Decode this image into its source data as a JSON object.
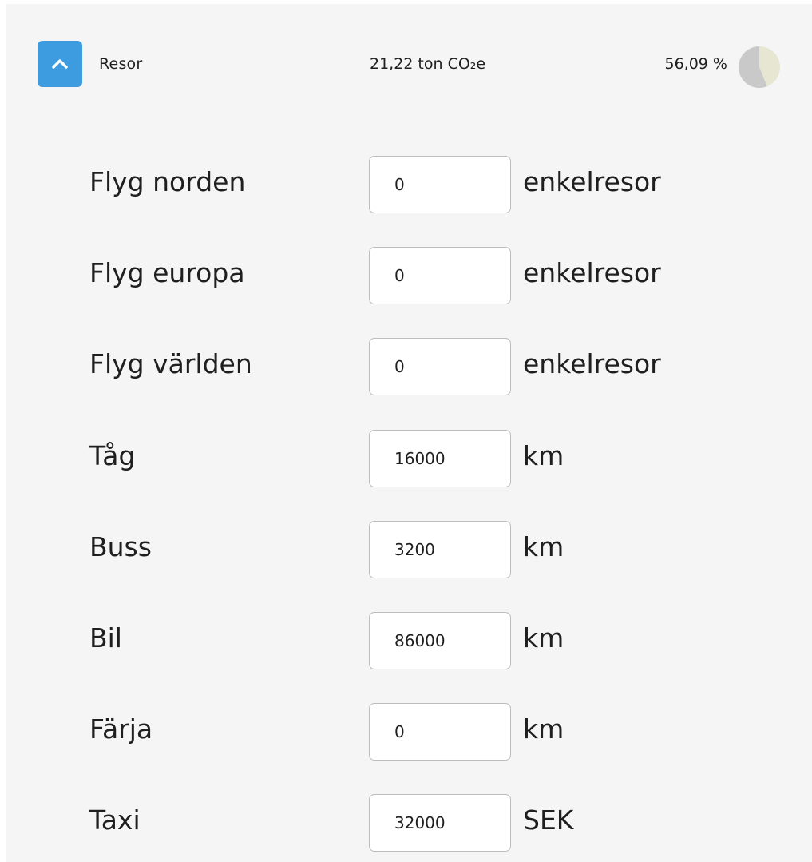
{
  "section": {
    "title": "Resor",
    "total": "21,22 ton CO₂e",
    "percent_label": "56,09 %",
    "percent_value": 56.09,
    "pie_colors": {
      "fill": "#c9c9c9",
      "background": "#e6e6d2"
    }
  },
  "toggle": {
    "icon": "chevron-up-icon",
    "color": "#3d9be0"
  },
  "rows": [
    {
      "label": "Flyg norden",
      "value": "0",
      "unit": "enkelresor"
    },
    {
      "label": "Flyg europa",
      "value": "0",
      "unit": "enkelresor"
    },
    {
      "label": "Flyg världen",
      "value": "0",
      "unit": "enkelresor"
    },
    {
      "label": "Tåg",
      "value": "16000",
      "unit": "km"
    },
    {
      "label": "Buss",
      "value": "3200",
      "unit": "km"
    },
    {
      "label": "Bil",
      "value": "86000",
      "unit": "km"
    },
    {
      "label": "Färja",
      "value": "0",
      "unit": "km"
    },
    {
      "label": "Taxi",
      "value": "32000",
      "unit": "SEK"
    }
  ]
}
